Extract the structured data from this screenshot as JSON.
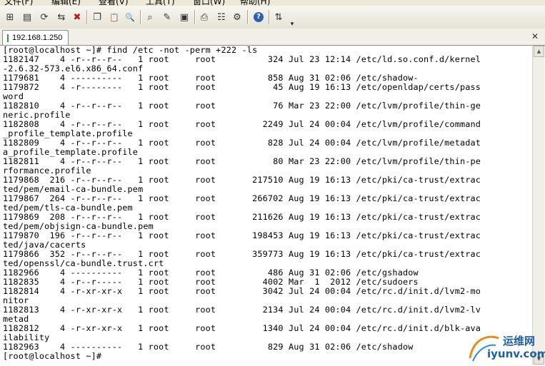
{
  "menubar": {
    "items": [
      "文件(F)",
      "编辑(E)",
      "查看(V)",
      "工具(T)",
      "窗口(W)",
      "帮助(H)"
    ]
  },
  "toolbar": {
    "buttons": [
      {
        "name": "new-session-button",
        "icon": "new-session-icon",
        "glyph": "⊞"
      },
      {
        "name": "open-session-button",
        "icon": "open-session-icon",
        "glyph": "▤"
      },
      {
        "name": "reconnect-button",
        "icon": "reconnect-icon",
        "glyph": "⟳"
      },
      {
        "name": "reconnect-all-button",
        "icon": "reconnect-all-icon",
        "glyph": "⇆"
      },
      {
        "name": "disconnect-button",
        "icon": "disconnect-icon",
        "glyph": "✖"
      },
      {
        "name": "copy-button",
        "icon": "copy-icon",
        "glyph": "❐"
      },
      {
        "name": "paste-button",
        "icon": "paste-icon",
        "glyph": "📋"
      },
      {
        "name": "find-button",
        "icon": "find-icon",
        "glyph": "🔍"
      },
      {
        "name": "find-next-button",
        "icon": "find-next-icon",
        "glyph": "⌕"
      },
      {
        "name": "log-session-button",
        "icon": "log-icon",
        "glyph": "✎"
      },
      {
        "name": "print-screen-button",
        "icon": "print-screen-icon",
        "glyph": "▣"
      },
      {
        "name": "print-button",
        "icon": "print-icon",
        "glyph": "⎙"
      },
      {
        "name": "session-options-button",
        "icon": "session-options-icon",
        "glyph": "☷"
      },
      {
        "name": "global-options-button",
        "icon": "global-options-icon",
        "glyph": "⚙"
      },
      {
        "name": "keymap-button",
        "icon": "keymap-icon",
        "glyph": "✱"
      },
      {
        "name": "help-button",
        "icon": "help-icon",
        "glyph": "?"
      },
      {
        "name": "sftp-button",
        "icon": "sftp-icon",
        "glyph": "⇅"
      }
    ],
    "overflow_glyph": "▾"
  },
  "tab": {
    "label": "192.168.1.250",
    "status_color": "#2e9d3e",
    "close_glyph": "✕"
  },
  "terminal": {
    "lines": [
      "[root@localhost ~]# find /etc -not -perm +222 -ls",
      "1182147    4 -r--r--r--   1 root     root          324 Jul 23 12:14 /etc/ld.so.conf.d/kernel",
      "-2.6.32-573.el6.x86_64.conf",
      "1179681    4 ----------   1 root     root          858 Aug 31 02:06 /etc/shadow-",
      "1179872    4 -r--------   1 root     root           45 Aug 19 16:13 /etc/openldap/certs/pass",
      "word",
      "1182810    4 -r--r--r--   1 root     root           76 Mar 23 22:00 /etc/lvm/profile/thin-ge",
      "neric.profile",
      "1182808    4 -r--r--r--   1 root     root         2249 Jul 24 00:04 /etc/lvm/profile/command",
      "_profile_template.profile",
      "1182809    4 -r--r--r--   1 root     root          828 Jul 24 00:04 /etc/lvm/profile/metadat",
      "a_profile_template.profile",
      "1182811    4 -r--r--r--   1 root     root           80 Mar 23 22:00 /etc/lvm/profile/thin-pe",
      "rformance.profile",
      "1179868  216 -r--r--r--   1 root     root       217510 Aug 19 16:13 /etc/pki/ca-trust/extrac",
      "ted/pem/email-ca-bundle.pem",
      "1179867  264 -r--r--r--   1 root     root       266702 Aug 19 16:13 /etc/pki/ca-trust/extrac",
      "ted/pem/tls-ca-bundle.pem",
      "1179869  208 -r--r--r--   1 root     root       211626 Aug 19 16:13 /etc/pki/ca-trust/extrac",
      "ted/pem/objsign-ca-bundle.pem",
      "1179870  196 -r--r--r--   1 root     root       198453 Aug 19 16:13 /etc/pki/ca-trust/extrac",
      "ted/java/cacerts",
      "1179866  352 -r--r--r--   1 root     root       359773 Aug 19 16:13 /etc/pki/ca-trust/extrac",
      "ted/openssl/ca-bundle.trust.crt",
      "1182966    4 ----------   1 root     root          486 Aug 31 02:06 /etc/gshadow",
      "1182835    4 -r--r-----   1 root     root         4002 Mar  1  2012 /etc/sudoers",
      "1182814    4 -r-xr-xr-x   1 root     root         3042 Jul 24 00:04 /etc/rc.d/init.d/lvm2-mo",
      "nitor",
      "1182813    4 -r-xr-xr-x   1 root     root         2134 Jul 24 00:04 /etc/rc.d/init.d/lvm2-lv",
      "metad",
      "1182812    4 -r-xr-xr-x   1 root     root         1340 Jul 24 00:04 /etc/rc.d/init.d/blk-ava",
      "ilability",
      "1182963    4 ----------   1 root     root          829 Aug 31 02:06 /etc/shadow",
      "[root@localhost ~]#"
    ]
  },
  "watermark": {
    "text_cn": "运维网",
    "url": "iyunv.com"
  }
}
